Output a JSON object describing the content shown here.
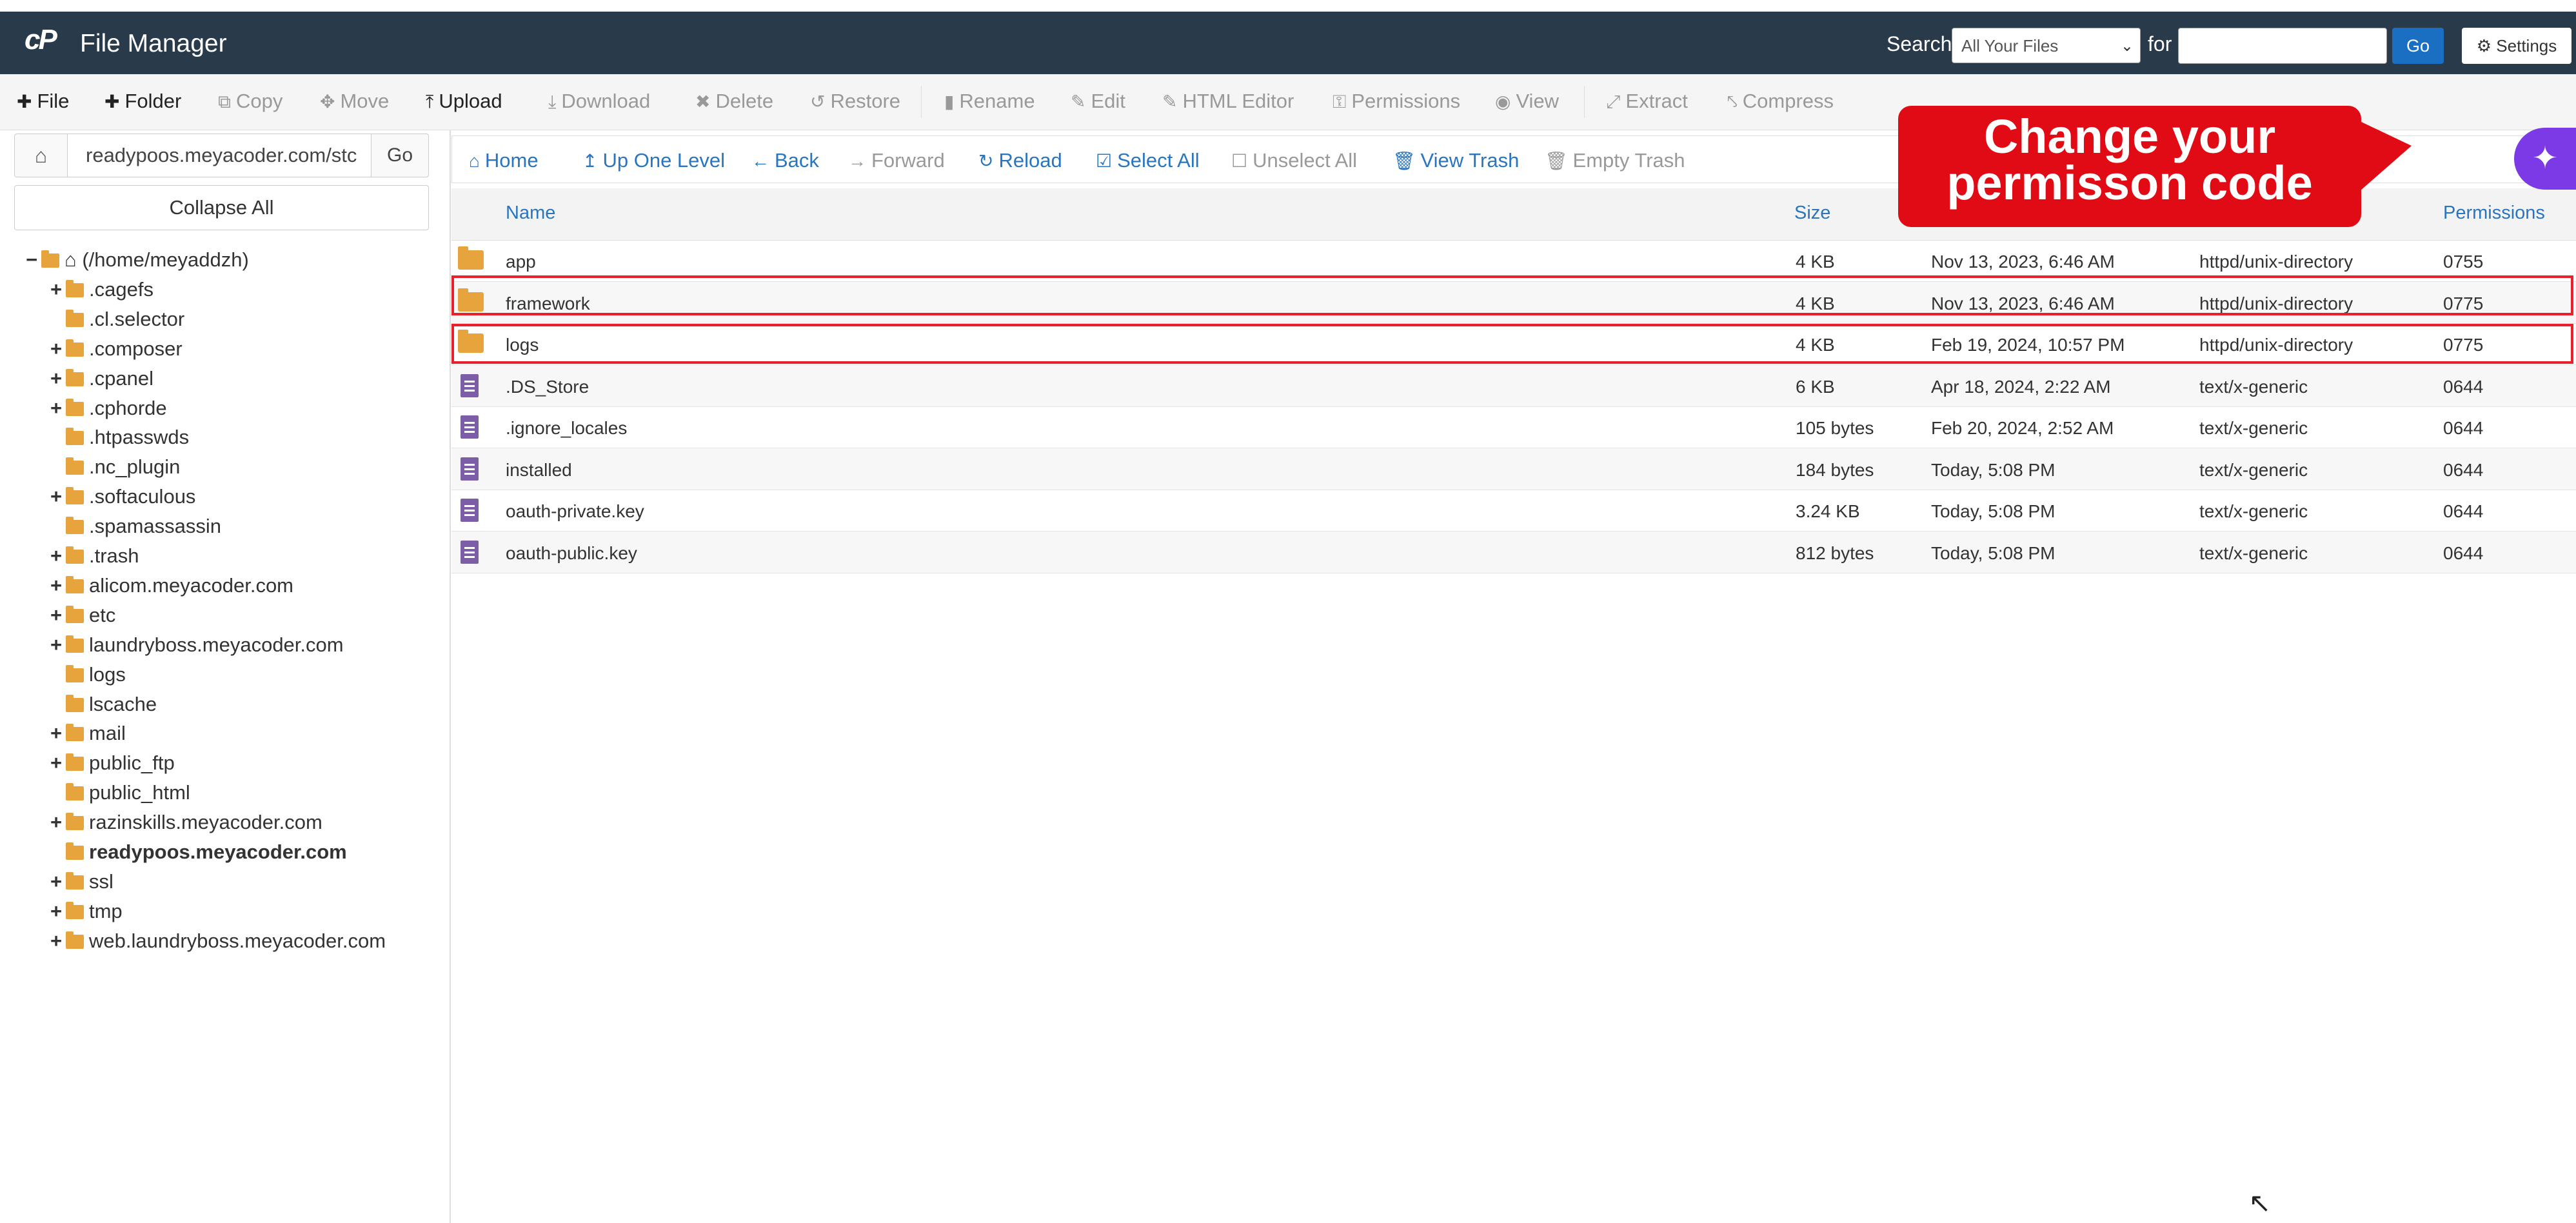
{
  "header": {
    "logo": "cP",
    "title": "File Manager",
    "search_label": "Search",
    "search_scope": "All Your Files",
    "for_label": "for",
    "search_value": "",
    "go_label": "Go",
    "settings_label": "Settings"
  },
  "toolbar": {
    "file": "File",
    "folder": "Folder",
    "copy": "Copy",
    "move": "Move",
    "upload": "Upload",
    "download": "Download",
    "delete": "Delete",
    "restore": "Restore",
    "rename": "Rename",
    "edit": "Edit",
    "html_editor": "HTML Editor",
    "permissions": "Permissions",
    "view": "View",
    "extract": "Extract",
    "compress": "Compress"
  },
  "sidebar": {
    "path_value": "readypoos.meyacoder.com/stc",
    "go_label": "Go",
    "collapse_label": "Collapse All",
    "tree_root": "(/home/meyaddzh)",
    "tree": [
      {
        "label": ".cagefs",
        "toggle": "+"
      },
      {
        "label": ".cl.selector",
        "toggle": ""
      },
      {
        "label": ".composer",
        "toggle": "+"
      },
      {
        "label": ".cpanel",
        "toggle": "+"
      },
      {
        "label": ".cphorde",
        "toggle": "+"
      },
      {
        "label": ".htpasswds",
        "toggle": ""
      },
      {
        "label": ".nc_plugin",
        "toggle": ""
      },
      {
        "label": ".softaculous",
        "toggle": "+"
      },
      {
        "label": ".spamassassin",
        "toggle": ""
      },
      {
        "label": ".trash",
        "toggle": "+"
      },
      {
        "label": "alicom.meyacoder.com",
        "toggle": "+"
      },
      {
        "label": "etc",
        "toggle": "+"
      },
      {
        "label": "laundryboss.meyacoder.com",
        "toggle": "+"
      },
      {
        "label": "logs",
        "toggle": ""
      },
      {
        "label": "lscache",
        "toggle": ""
      },
      {
        "label": "mail",
        "toggle": "+"
      },
      {
        "label": "public_ftp",
        "toggle": "+"
      },
      {
        "label": "public_html",
        "toggle": ""
      },
      {
        "label": "razinskills.meyacoder.com",
        "toggle": "+"
      },
      {
        "label": "readypoos.meyacoder.com",
        "toggle": ""
      },
      {
        "label": "ssl",
        "toggle": "+"
      },
      {
        "label": "tmp",
        "toggle": "+"
      },
      {
        "label": "web.laundryboss.meyacoder.com",
        "toggle": "+"
      }
    ]
  },
  "nav": {
    "home": "Home",
    "up": "Up One Level",
    "back": "Back",
    "forward": "Forward",
    "reload": "Reload",
    "select_all": "Select All",
    "unselect_all": "Unselect All",
    "view_trash": "View Trash",
    "empty_trash": "Empty Trash"
  },
  "table": {
    "columns": {
      "name": "Name",
      "size": "Size",
      "permissions": "Permissions"
    },
    "rows": [
      {
        "icon": "folder",
        "name": "app",
        "size": "4 KB",
        "modified": "Nov 13, 2023, 6:46 AM",
        "type": "httpd/unix-directory",
        "perms": "0755"
      },
      {
        "icon": "folder",
        "name": "framework",
        "size": "4 KB",
        "modified": "Nov 13, 2023, 6:46 AM",
        "type": "httpd/unix-directory",
        "perms": "0775"
      },
      {
        "icon": "folder",
        "name": "logs",
        "size": "4 KB",
        "modified": "Feb 19, 2024, 10:57 PM",
        "type": "httpd/unix-directory",
        "perms": "0775"
      },
      {
        "icon": "file",
        "name": ".DS_Store",
        "size": "6 KB",
        "modified": "Apr 18, 2024, 2:22 AM",
        "type": "text/x-generic",
        "perms": "0644"
      },
      {
        "icon": "file",
        "name": ".ignore_locales",
        "size": "105 bytes",
        "modified": "Feb 20, 2024, 2:52 AM",
        "type": "text/x-generic",
        "perms": "0644"
      },
      {
        "icon": "file",
        "name": "installed",
        "size": "184 bytes",
        "modified": "Today, 5:08 PM",
        "type": "text/x-generic",
        "perms": "0644"
      },
      {
        "icon": "file",
        "name": "oauth-private.key",
        "size": "3.24 KB",
        "modified": "Today, 5:08 PM",
        "type": "text/x-generic",
        "perms": "0644"
      },
      {
        "icon": "file",
        "name": "oauth-public.key",
        "size": "812 bytes",
        "modified": "Today, 5:08 PM",
        "type": "text/x-generic",
        "perms": "0644"
      }
    ]
  },
  "callout": {
    "text": "Change your permisson code"
  },
  "colors": {
    "header_bg": "#293a4a",
    "accent_blue": "#2a75c0",
    "highlight_red": "#e8202a",
    "callout_red": "#e00b14",
    "folder": "#e8a43c",
    "file": "#7b5ea7"
  }
}
